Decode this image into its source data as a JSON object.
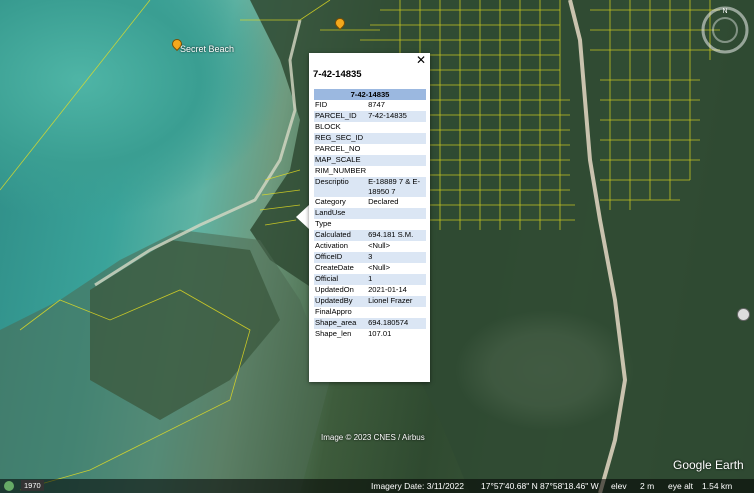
{
  "map": {
    "place_label": "Secret Beach",
    "image_credit": "Image © 2023 CNES / Airbus",
    "logo": "Google Earth",
    "compass_letter": "N"
  },
  "popup": {
    "title": "7-42-14835",
    "close_symbol": "✕",
    "table_header": "7-42-14835",
    "rows": [
      {
        "k": "FID",
        "v": "8747"
      },
      {
        "k": "PARCEL_ID",
        "v": "7-42-14835"
      },
      {
        "k": "BLOCK",
        "v": ""
      },
      {
        "k": "REG_SEC_ID",
        "v": ""
      },
      {
        "k": "PARCEL_NO",
        "v": ""
      },
      {
        "k": "MAP_SCALE",
        "v": ""
      },
      {
        "k": "RIM_NUMBER",
        "v": ""
      },
      {
        "k": "Descriptio",
        "v": "E-18889 7 & E-18950 7"
      },
      {
        "k": "Category",
        "v": "Declared"
      },
      {
        "k": "LandUse",
        "v": ""
      },
      {
        "k": "Type",
        "v": ""
      },
      {
        "k": "Calculated",
        "v": "694.181 S.M."
      },
      {
        "k": "Activation",
        "v": "<Null>"
      },
      {
        "k": "OfficeID",
        "v": "3"
      },
      {
        "k": "CreateDate",
        "v": "<Null>"
      },
      {
        "k": "Official",
        "v": "1"
      },
      {
        "k": "UpdatedOn",
        "v": "2021-01-14"
      },
      {
        "k": "UpdatedBy",
        "v": "Lionel Frazer"
      },
      {
        "k": "FinalAppro",
        "v": ""
      },
      {
        "k": "Shape_area",
        "v": "694.180574"
      },
      {
        "k": "Shape_len",
        "v": "107.01"
      }
    ]
  },
  "statusbar": {
    "year": "1970",
    "imagery_date": "Imagery Date: 3/11/2022",
    "lat": "17°57'40.68\" N",
    "lon": "87°58'18.46\" W",
    "elev_label": "elev",
    "elev_value": "2 m",
    "eye_alt_label": "eye alt",
    "eye_alt_value": "1.54 km"
  },
  "colors": {
    "parcel_lines": "#e8e020",
    "header": "#9bb8e0",
    "shade": "#dbe6f4"
  }
}
